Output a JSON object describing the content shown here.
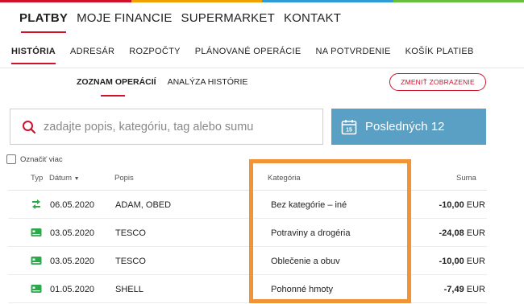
{
  "colorbar": [
    "#d0112b",
    "#f0a000",
    "#2f9bd7",
    "#6abf3c"
  ],
  "topnav": {
    "items": [
      {
        "label": "PLATBY",
        "active": true
      },
      {
        "label": "MOJE FINANCIE",
        "active": false
      },
      {
        "label": "SUPERMARKET",
        "active": false
      },
      {
        "label": "KONTAKT",
        "active": false
      }
    ]
  },
  "subnav": {
    "items": [
      {
        "label": "HISTÓRIA",
        "active": true
      },
      {
        "label": "ADRESÁR",
        "active": false
      },
      {
        "label": "ROZPOČTY",
        "active": false
      },
      {
        "label": "PLÁNOVANÉ OPERÁCIE",
        "active": false
      },
      {
        "label": "NA POTVRDENIE",
        "active": false
      },
      {
        "label": "KOŠÍK PLATIEB",
        "active": false
      }
    ]
  },
  "viewtabs": {
    "items": [
      {
        "label": "ZOZNAM OPERÁCIÍ",
        "active": true
      },
      {
        "label": "ANALÝZA HISTÓRIE",
        "active": false
      }
    ]
  },
  "change_view_label": "ZMENIŤ ZOBRAZENIE",
  "search": {
    "placeholder": "zadajte popis, kategóriu, tag alebo sumu",
    "value": ""
  },
  "period": {
    "label": "Posledných 12",
    "calendar_day": "15"
  },
  "select_all_label": "Označiť viac",
  "table": {
    "headers": {
      "type": "Typ",
      "date": "Dátum",
      "date_sort": "▼",
      "description": "Popis",
      "category": "Kategória",
      "amount": "Suma"
    },
    "rows": [
      {
        "icon": "transfer-icon",
        "date": "06.05.2020",
        "description": "ADAM, OBED",
        "category": "Bez kategórie – iné",
        "amount": "-10,00",
        "currency": "EUR"
      },
      {
        "icon": "card-icon",
        "date": "03.05.2020",
        "description": "TESCO",
        "category": "Potraviny a drogéria",
        "amount": "-24,08",
        "currency": "EUR"
      },
      {
        "icon": "card-icon",
        "date": "03.05.2020",
        "description": "TESCO",
        "category": "Oblečenie a obuv",
        "amount": "-10,00",
        "currency": "EUR"
      },
      {
        "icon": "card-icon",
        "date": "01.05.2020",
        "description": "SHELL",
        "category": "Pohonné hmoty",
        "amount": "-7,49",
        "currency": "EUR"
      }
    ]
  },
  "colors": {
    "accent": "#d0112b",
    "button_blue": "#5a9fc4",
    "highlight": "#f39434",
    "icon_green": "#2aa84a"
  }
}
